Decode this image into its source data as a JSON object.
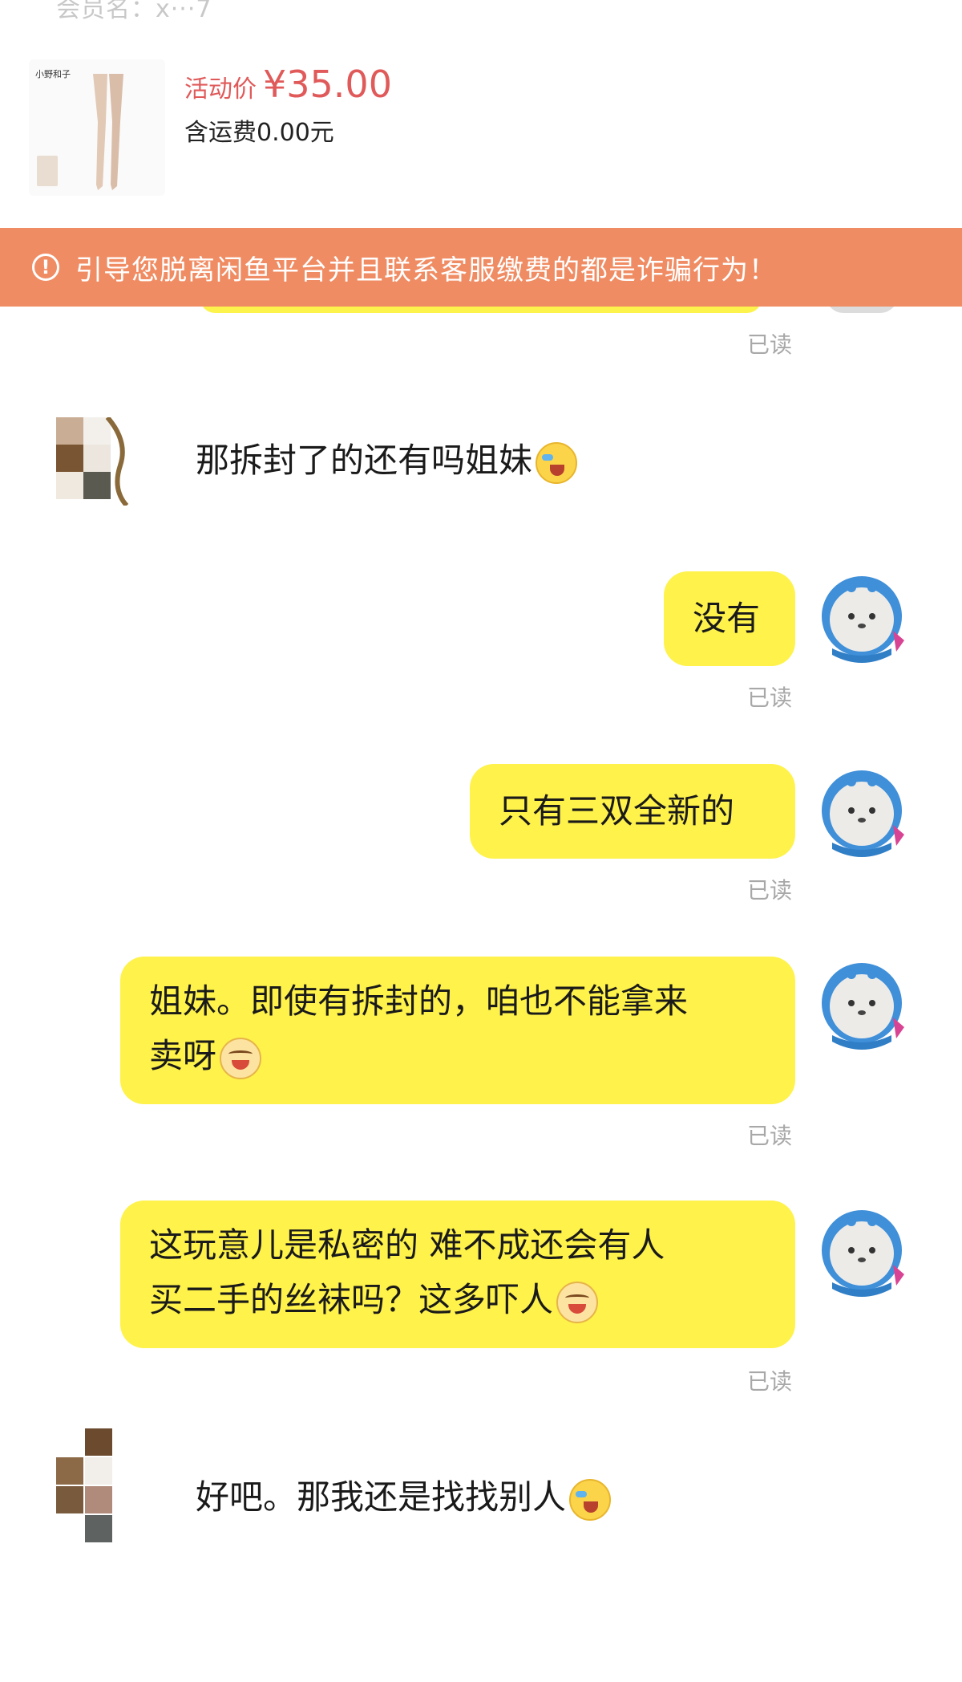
{
  "header": {
    "cut_text": "会员名：x···7"
  },
  "product": {
    "brand": "小野和子",
    "price_label": "活动价",
    "price_value": "¥35.00",
    "shipping": "含运费0.00元"
  },
  "warning": {
    "icon": "info-icon",
    "text": "引导您脱离闲鱼平台并且联系客服缴费的都是诈骗行为！"
  },
  "colors": {
    "bubble_self": "#fef24b",
    "warning_banner": "#f08c63",
    "price": "#e05a5a"
  },
  "read_label": "已读",
  "messages": [
    {
      "side": "left",
      "text": "那拆封了的还有吗姐妹",
      "emoji": "cry-laugh-emoji"
    },
    {
      "side": "right",
      "text": "没有"
    },
    {
      "side": "right",
      "text": "只有三双全新的"
    },
    {
      "side": "right",
      "line1": "姐妹。即使有拆封的，咱也不能拿来",
      "line2": "卖呀",
      "emoji": "smile-emoji"
    },
    {
      "side": "right",
      "line1": "这玩意儿是私密的 难不成还会有人",
      "line2": "买二手的丝袜吗？这多吓人",
      "emoji": "smile-emoji"
    },
    {
      "side": "left",
      "text": "好吧。那我还是找找别人",
      "emoji": "cry-laugh-emoji"
    }
  ]
}
